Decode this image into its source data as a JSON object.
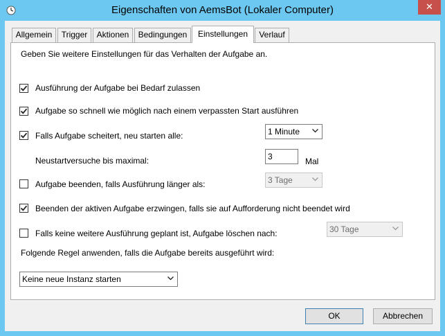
{
  "window": {
    "title": "Eigenschaften von AemsBot (Lokaler Computer)",
    "close_symbol": "✕"
  },
  "tabs": [
    {
      "label": "Allgemein"
    },
    {
      "label": "Trigger"
    },
    {
      "label": "Aktionen"
    },
    {
      "label": "Bedingungen"
    },
    {
      "label": "Einstellungen"
    },
    {
      "label": "Verlauf"
    }
  ],
  "active_tab": "Einstellungen",
  "settings": {
    "intro": "Geben Sie weitere Einstellungen für das Verhalten der Aufgabe an.",
    "allow_on_demand": {
      "label": "Ausführung der Aufgabe bei Bedarf zulassen",
      "checked": true
    },
    "run_after_missed": {
      "label": "Aufgabe so schnell wie möglich nach einem verpassten Start ausführen",
      "checked": true
    },
    "restart_on_fail": {
      "label": "Falls Aufgabe scheitert, neu starten alle:",
      "checked": true,
      "interval": "1 Minute"
    },
    "retry": {
      "label": "Neustartversuche bis maximal:",
      "value": "3",
      "unit": "Mal"
    },
    "stop_if_longer": {
      "label": "Aufgabe beenden, falls Ausführung länger als:",
      "checked": false,
      "duration": "3 Tage"
    },
    "force_stop": {
      "label": "Beenden der aktiven Aufgabe erzwingen, falls sie auf Aufforderung nicht beendet wird",
      "checked": true
    },
    "delete_if_none": {
      "label": "Falls keine weitere Ausführung geplant ist, Aufgabe löschen nach:",
      "checked": false,
      "duration": "30 Tage"
    },
    "rule_label": "Folgende Regel anwenden, falls die Aufgabe bereits ausgeführt wird:",
    "rule_value": "Keine neue Instanz starten"
  },
  "buttons": {
    "ok": "OK",
    "cancel": "Abbrechen"
  }
}
